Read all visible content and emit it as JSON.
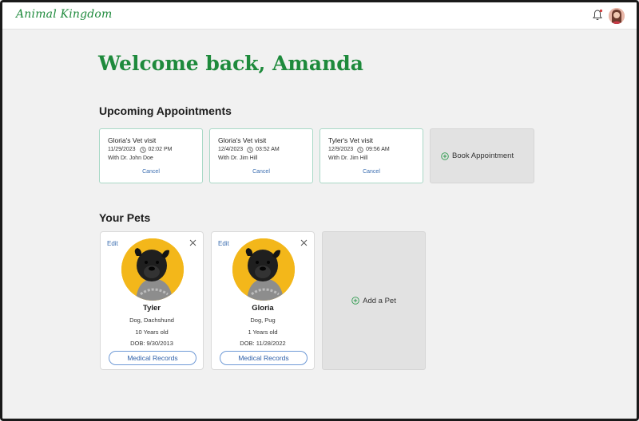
{
  "app": {
    "brand": "Animal Kingdom"
  },
  "header": {
    "welcome": "Welcome back, Amanda"
  },
  "sections": {
    "appointments": "Upcoming Appointments",
    "pets": "Your Pets"
  },
  "appointments": [
    {
      "title": "Gloria's Vet visit",
      "date": "11/29/2023",
      "time": "02:02 PM",
      "with": "With Dr. John Doe",
      "cancel": "Cancel"
    },
    {
      "title": "Gloria's Vet visit",
      "date": "12/4/2023",
      "time": "03:52 AM",
      "with": "With Dr. Jim Hill",
      "cancel": "Cancel"
    },
    {
      "title": "Tyler's Vet visit",
      "date": "12/9/2023",
      "time": "09:56 AM",
      "with": "With Dr. Jim Hill",
      "cancel": "Cancel"
    }
  ],
  "book": {
    "label": "Book Appointment"
  },
  "pets": [
    {
      "edit": "Edit",
      "name": "Tyler",
      "breed": "Dog, Dachshund",
      "age": "10 Years old",
      "dob": "DOB: 9/30/2013",
      "records": "Medical Records"
    },
    {
      "edit": "Edit",
      "name": "Gloria",
      "breed": "Dog, Pug",
      "age": "1 Years old",
      "dob": "DOB: 11/28/2022",
      "records": "Medical Records"
    }
  ],
  "add_pet": {
    "label": "Add a Pet"
  },
  "icons": {
    "bell": "bell-icon",
    "avatar": "user-avatar",
    "clock": "clock-icon",
    "close": "close-icon",
    "plus": "plus-circle-icon"
  },
  "colors": {
    "brand": "#1e8a3c",
    "link": "#3a6db0",
    "card_border": "#a8d8c6",
    "pet_bg": "#f3b71a"
  }
}
